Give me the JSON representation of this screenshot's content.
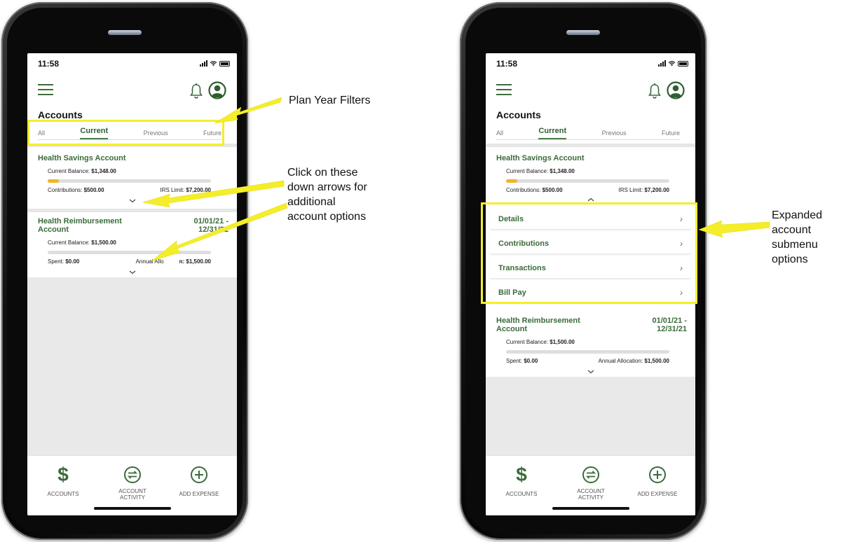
{
  "status": {
    "time": "11:58"
  },
  "screen": {
    "accounts_title": "Accounts",
    "filters": [
      "All",
      "Current",
      "Previous",
      "Future"
    ]
  },
  "hsa": {
    "title": "Health Savings Account",
    "balance_label": "Current Balance: ",
    "balance_value": "$1,348.00",
    "contrib_label": "Contributions: ",
    "contrib_value": "$500.00",
    "limit_label": "IRS Limit: ",
    "limit_value": "$7,200.00",
    "progress_fraction": 0.069
  },
  "hra": {
    "title_line1": "Health Reimbursement",
    "title_line2": "Account",
    "date_line1": "01/01/21 -",
    "date_line2": "12/31/21",
    "balance_label": "Current Balance: ",
    "balance_value": "$1,500.00",
    "spent_label": "Spent: ",
    "spent_value": "$0.00",
    "alloc_label": "Annual Allocation: ",
    "alloc_value": "$1,500.00",
    "alloc_obscured_left": "Annual Allo",
    "alloc_obscured_right": "n: $1,500.00",
    "progress_fraction": 0
  },
  "submenu": [
    "Details",
    "Contributions",
    "Transactions",
    "Bill Pay"
  ],
  "bottom_nav": {
    "accounts": "ACCOUNTS",
    "activity_line1": "ACCOUNT",
    "activity_line2": "ACTIVITY",
    "add_expense": "ADD EXPENSE"
  },
  "annotations": {
    "plan_year": "Plan Year Filters",
    "click_lines": [
      "Click on these",
      "down arrows for",
      "additional",
      "account options"
    ],
    "expanded_lines": [
      "Expanded",
      "account",
      "submenu",
      "options"
    ]
  },
  "colors": {
    "accent": "#3a6b3a",
    "progress": "#f0b429",
    "highlight": "#f4ee2a"
  },
  "icons": [
    "menu-icon",
    "bell-icon",
    "avatar-icon",
    "chevron-down-icon",
    "chevron-up-icon",
    "chevron-right-icon",
    "dollar-icon",
    "activity-icon",
    "add-icon"
  ]
}
